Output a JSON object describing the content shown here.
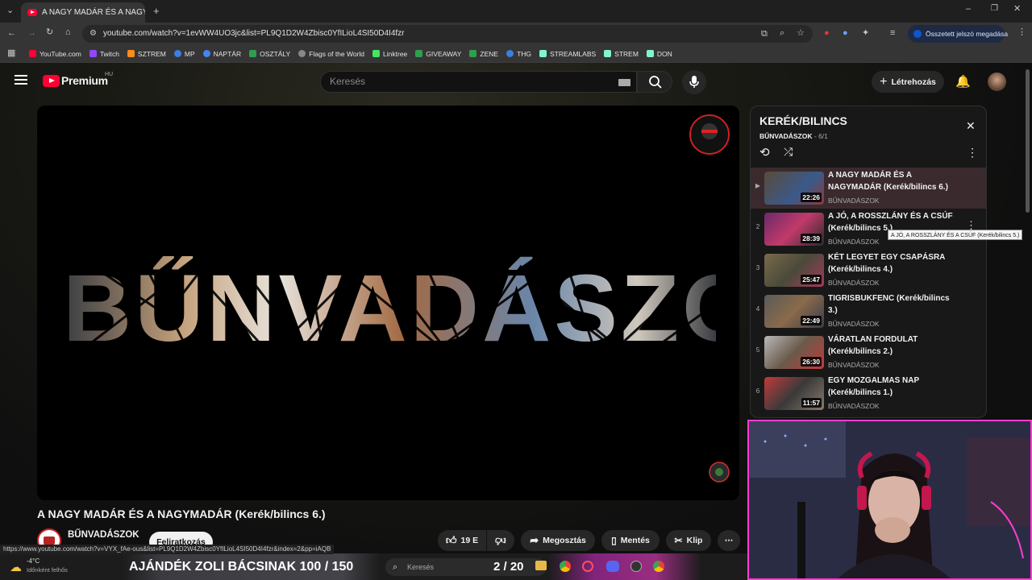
{
  "browser": {
    "tab_title": "A NAGY MADÁR ÉS A NAGYMADÁR",
    "url": "youtube.com/watch?v=1evWW4UO3jc&list=PL9Q1D2W4Zbisc0YfILioL4SI50D4I4fzr",
    "password_button": "Összetett jelszó megadása",
    "bookmarks": [
      "YouTube.com",
      "Twitch",
      "SZTREM",
      "MP",
      "NAPTÁR",
      "OSZTÁLY",
      "Flags of the World",
      "Linktree",
      "GIVEAWAY",
      "ZENE",
      "THG",
      "STREAMLABS",
      "STREM",
      "DON"
    ]
  },
  "header": {
    "logo": "Premium",
    "region": "HU",
    "search_placeholder": "Keresés",
    "create_label": "Létrehozás"
  },
  "video": {
    "overlay_text": "BŰNVADÁSZOK",
    "title": "A NAGY MADÁR ÉS A NAGYMADÁR (Kerék/bilincs 6.)",
    "channel": "BŰNVADÁSZOK",
    "subscribe_label": "Feliratkozás",
    "likes": "19 E",
    "share_label": "Megosztás",
    "save_label": "Mentés",
    "clip_label": "Klip"
  },
  "playlist": {
    "title": "KERÉK/BILINCS",
    "channel": "BŰNVADÁSZOK",
    "position": "6/1",
    "tooltip": "A JÓ, A ROSSZLÁNY ÉS A CSÚF (Kerék/bilincs 5.)",
    "items": [
      {
        "num": "▶",
        "title": "A NAGY MADÁR ÉS A NAGYMADÁR (Kerék/bilincs 6.)",
        "channel": "BŰNVADÁSZOK",
        "duration": "22:26"
      },
      {
        "num": "2",
        "title": "A JÓ, A ROSSZLÁNY ÉS A CSÚF (Kerék/bilincs 5.)",
        "channel": "BŰNVADÁSZOK",
        "duration": "28:39"
      },
      {
        "num": "3",
        "title": "KÉT LEGYET EGY CSAPÁSRA (Kerék/bilincs 4.)",
        "channel": "BŰNVADÁSZOK",
        "duration": "25:47"
      },
      {
        "num": "4",
        "title": "TIGRISBUKFENC (Kerék/bilincs 3.)",
        "channel": "BŰNVADÁSZOK",
        "duration": "22:49"
      },
      {
        "num": "5",
        "title": "VÁRATLAN FORDULAT (Kerék/bilincs 2.)",
        "channel": "BŰNVADÁSZOK",
        "duration": "26:30"
      },
      {
        "num": "6",
        "title": "EGY MOZGALMAS NAP (Kerék/bilincs 1.)",
        "channel": "BŰNVADÁSZOK",
        "duration": "11:57"
      }
    ]
  },
  "status_url": "https://www.youtube.com/watch?v=VYX_fAe-ous&list=PL9Q1D2W4Zbisc0YfILioL4SI50D4I4fzr&index=2&pp=iAQB",
  "taskbar": {
    "weather_temp": "-4°C",
    "weather_desc": "Időnként felhős",
    "marquee": "AJÁNDÉK ZOLI BÁCSINAK 100 / 150",
    "search_placeholder": "Keresés",
    "goal": "2 / 20"
  },
  "colors": {
    "accent": "#ff0033",
    "webcam_border": "#ff3cd2"
  }
}
